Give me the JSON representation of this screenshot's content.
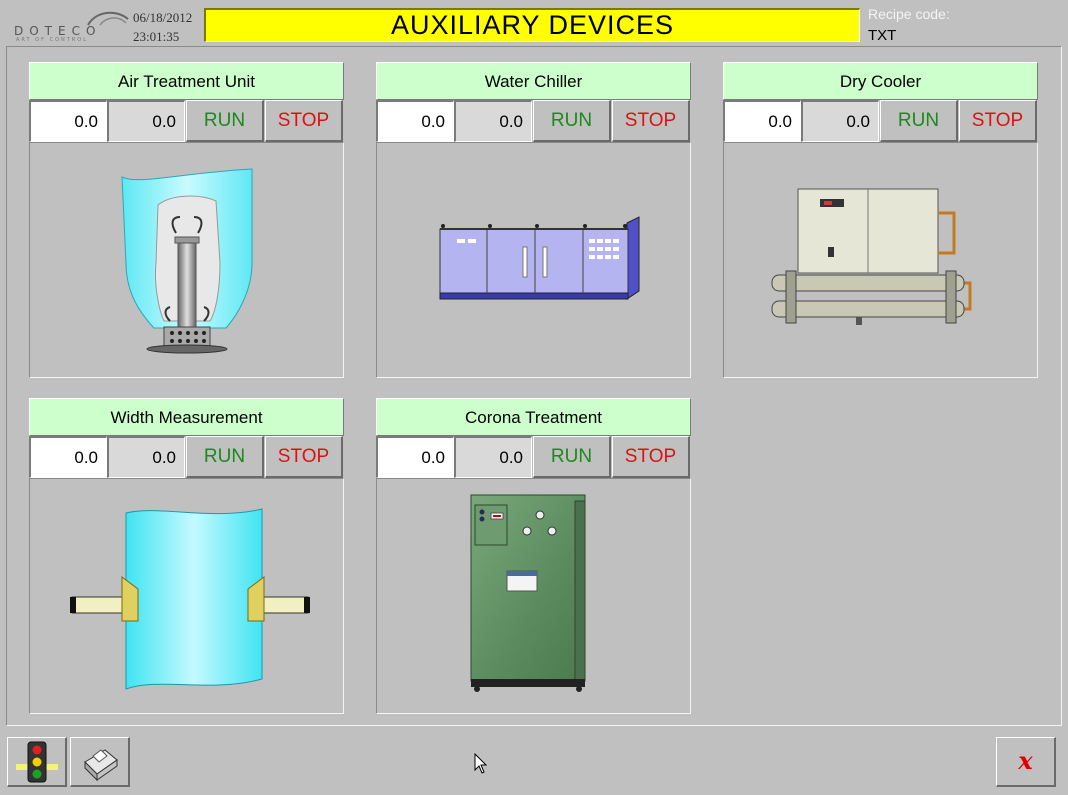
{
  "header": {
    "logo_text": "DOTECO",
    "logo_tagline": "ART OF CONTROL",
    "date": "06/18/2012",
    "time": "23:01:35",
    "title": "AUXILIARY  DEVICES",
    "recipe_label": "Recipe code:",
    "recipe_value": "TXT"
  },
  "panels": [
    {
      "title": "Air Treatment Unit",
      "value1": "0.0",
      "value2": "0.0",
      "run_label": "RUN",
      "stop_label": "STOP",
      "icon": "air-treatment-unit-icon"
    },
    {
      "title": "Water Chiller",
      "value1": "0.0",
      "value2": "0.0",
      "run_label": "RUN",
      "stop_label": "STOP",
      "icon": "water-chiller-icon"
    },
    {
      "title": "Dry Cooler",
      "value1": "0.0",
      "value2": "0.0",
      "run_label": "RUN",
      "stop_label": "STOP",
      "icon": "dry-cooler-icon"
    },
    {
      "title": "Width Measurement",
      "value1": "0.0",
      "value2": "0.0",
      "run_label": "RUN",
      "stop_label": "STOP",
      "icon": "width-measurement-icon"
    },
    {
      "title": "Corona Treatment",
      "value1": "0.0",
      "value2": "0.0",
      "run_label": "RUN",
      "stop_label": "STOP",
      "icon": "corona-treatment-icon"
    }
  ],
  "footer": {
    "traffic_light_icon": "traffic-light-icon",
    "printer_icon": "printer-icon",
    "close_label": "x"
  },
  "colors": {
    "title_bg": "#ffff00",
    "panel_title_bg": "#ccffcc",
    "run": "#1a8a1a",
    "stop": "#e01010",
    "background": "#c0c0c0"
  }
}
